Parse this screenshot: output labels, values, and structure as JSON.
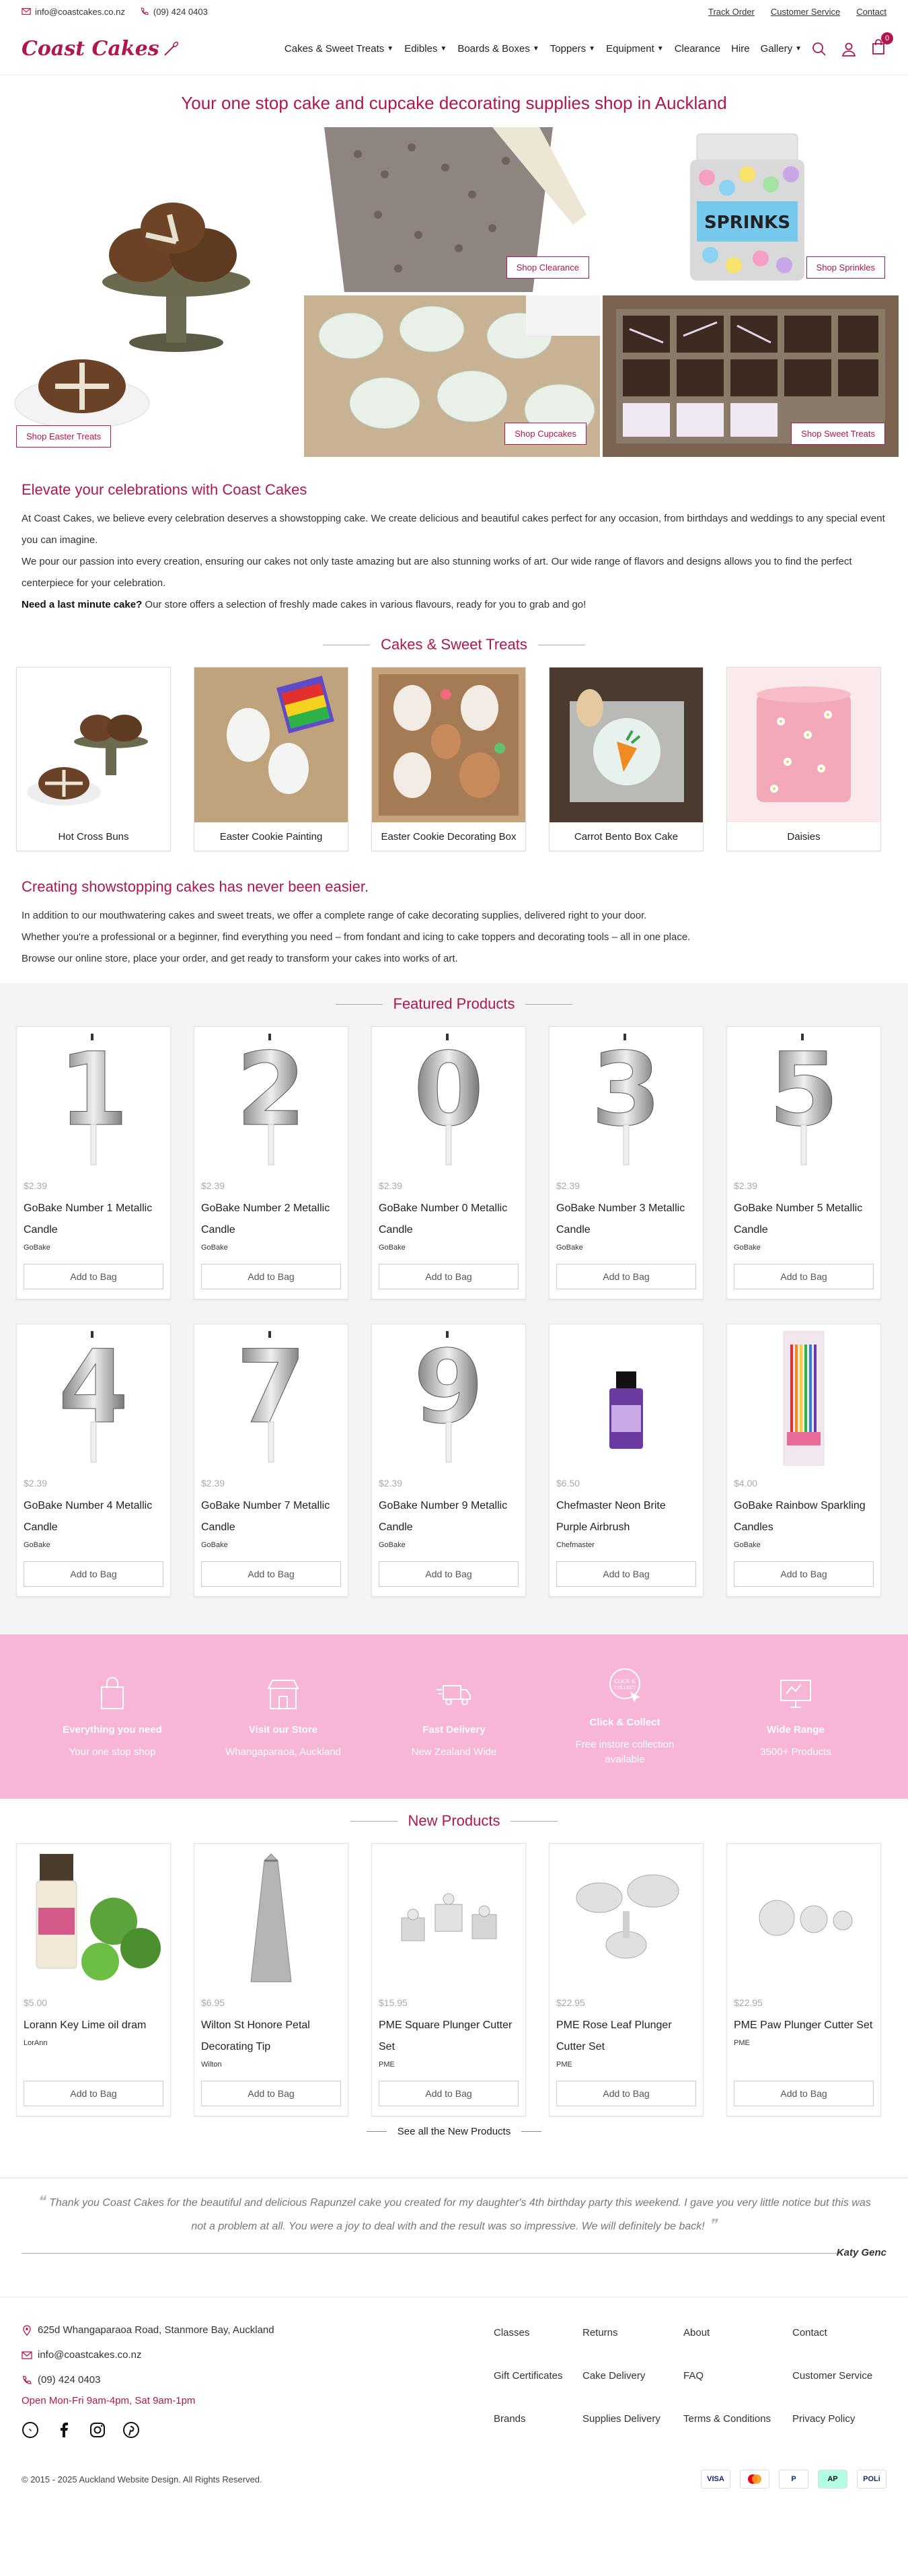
{
  "topbar": {
    "email": "info@coastcakes.co.nz",
    "phone": "(09) 424 0403",
    "links": [
      "Track Order",
      "Customer Service",
      "Contact"
    ]
  },
  "header": {
    "logo": "Coast Cakes",
    "nav": [
      {
        "label": "Cakes & Sweet Treats",
        "dropdown": true
      },
      {
        "label": "Edibles",
        "dropdown": true
      },
      {
        "label": "Boards & Boxes",
        "dropdown": true
      },
      {
        "label": "Toppers",
        "dropdown": true
      },
      {
        "label": "Equipment",
        "dropdown": true
      },
      {
        "label": "Clearance",
        "dropdown": false
      },
      {
        "label": "Hire",
        "dropdown": false
      },
      {
        "label": "Gallery",
        "dropdown": true
      }
    ],
    "cart_count": "0"
  },
  "tagline": "Your one stop cake and cupcake decorating supplies shop in Auckland",
  "hero": {
    "easter": "Shop Easter Treats",
    "clearance": "Shop Clearance",
    "sprinkles": "Shop Sprinkles",
    "cupcakes": "Shop Cupcakes",
    "sweet": "Shop Sweet Treats",
    "jar_text": "SPRINKS"
  },
  "intro": {
    "heading": "Elevate your celebrations with Coast Cakes",
    "p1": "At Coast Cakes, we believe every celebration deserves a showstopping cake. We create delicious and beautiful cakes perfect for any occasion, from birthdays and weddings to any special event you can imagine.",
    "p2": "We pour our passion into every creation, ensuring our cakes not only taste amazing but are also stunning works of art. Our wide range of flavors and designs allows you to find the perfect centerpiece for your celebration.",
    "p3_bold": "Need a last minute cake?",
    "p3": " Our store offers a selection of freshly made cakes in various flavours, ready for you to grab and go!"
  },
  "cakes_section": {
    "title": "Cakes & Sweet Treats",
    "items": [
      "Hot Cross Buns",
      "Easter Cookie Painting",
      "Easter Cookie Decorating Box",
      "Carrot Bento Box Cake",
      "Daisies"
    ]
  },
  "create": {
    "heading": "Creating showstopping cakes has never been easier.",
    "p1": "In addition to our mouthwatering cakes and sweet treats, we offer a complete range of cake decorating supplies, delivered right to your door.",
    "p2": "Whether you're a professional or a beginner, find everything you need – from fondant and icing to cake toppers and decorating tools – all in one place.",
    "p3": "Browse our online store, place your order, and get ready to transform your cakes into works of art."
  },
  "featured": {
    "title": "Featured Products",
    "add_label": "Add to Bag",
    "row1": [
      {
        "price": "$2.39",
        "name": "GoBake Number 1 Metallic Candle",
        "brand": "GoBake",
        "digit": "1"
      },
      {
        "price": "$2.39",
        "name": "GoBake Number 2 Metallic Candle",
        "brand": "GoBake",
        "digit": "2"
      },
      {
        "price": "$2.39",
        "name": "GoBake Number 0 Metallic Candle",
        "brand": "GoBake",
        "digit": "0"
      },
      {
        "price": "$2.39",
        "name": "GoBake Number 3 Metallic Candle",
        "brand": "GoBake",
        "digit": "3"
      },
      {
        "price": "$2.39",
        "name": "GoBake Number 5 Metallic Candle",
        "brand": "GoBake",
        "digit": "5"
      }
    ],
    "row2": [
      {
        "price": "$2.39",
        "name": "GoBake Number 4 Metallic Candle",
        "brand": "GoBake",
        "digit": "4"
      },
      {
        "price": "$2.39",
        "name": "GoBake Number 7 Metallic Candle",
        "brand": "GoBake",
        "digit": "7"
      },
      {
        "price": "$2.39",
        "name": "GoBake Number 9 Metallic Candle",
        "brand": "GoBake",
        "digit": "9"
      },
      {
        "price": "$6.50",
        "name": "Chefmaster Neon Brite Purple Airbrush",
        "brand": "Chefmaster"
      },
      {
        "price": "$4.00",
        "name": "GoBake Rainbow Sparkling Candles",
        "brand": "GoBake"
      }
    ]
  },
  "features": [
    {
      "icon": "bag-icon",
      "title": "Everything you need",
      "sub": "Your one stop shop"
    },
    {
      "icon": "store-icon",
      "title": "Visit our Store",
      "sub": "Whangaparaoa, Auckland"
    },
    {
      "icon": "truck-icon",
      "title": "Fast Delivery",
      "sub": "New Zealand Wide"
    },
    {
      "icon": "click-collect-icon",
      "title": "Click & Collect",
      "sub": "Free instore collection available"
    },
    {
      "icon": "monitor-icon",
      "title": "Wide Range",
      "sub": "3500+ Products"
    }
  ],
  "new_products": {
    "title": "New Products",
    "items": [
      {
        "price": "$5.00",
        "name": "Lorann Key Lime oil dram",
        "brand": "LorAnn"
      },
      {
        "price": "$6.95",
        "name": "Wilton St Honore Petal Decorating Tip",
        "brand": "Wilton"
      },
      {
        "price": "$15.95",
        "name": "PME Square Plunger Cutter Set",
        "brand": "PME"
      },
      {
        "price": "$22.95",
        "name": "PME Rose Leaf Plunger Cutter Set",
        "brand": "PME"
      },
      {
        "price": "$22.95",
        "name": "PME Paw Plunger Cutter Set",
        "brand": "PME"
      }
    ],
    "see_all": "See all the New Products"
  },
  "testimonial": {
    "quote": "Thank you Coast Cakes for the beautiful and delicious Rapunzel cake you created for my daughter's 4th birthday party this weekend. I gave you very little notice but this was not a problem at all. You were a joy to deal with and the result was so impressive. We will definitely be back!",
    "author": "Katy Genc"
  },
  "footer": {
    "address": "625d Whangaparaoa Road, Stanmore Bay, Auckland",
    "email": "info@coastcakes.co.nz",
    "phone": "(09) 424 0403",
    "hours": "Open Mon-Fri 9am-4pm, Sat 9am-1pm",
    "links": [
      "Classes",
      "Returns",
      "About",
      "Contact",
      "Gift Certificates",
      "Cake Delivery",
      "FAQ",
      "Customer Service",
      "Brands",
      "Supplies Delivery",
      "Terms & Conditions",
      "Privacy Policy"
    ],
    "copyright": "© 2015 - 2025 Auckland Website Design. All Rights Reserved.",
    "payments": [
      "VISA",
      "MC",
      "P",
      "AP",
      "POLi"
    ]
  },
  "colors": {
    "brand": "#b0164f",
    "band": "#f7b5d8"
  }
}
